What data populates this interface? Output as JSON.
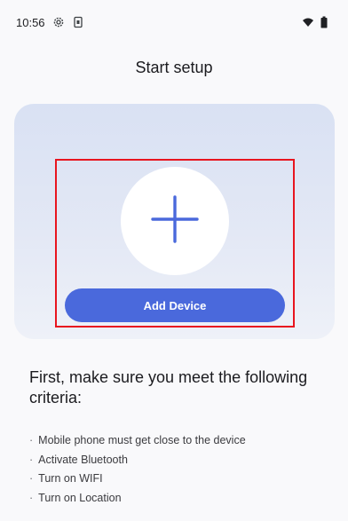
{
  "status_bar": {
    "time": "10:56",
    "icons": [
      "gear-icon",
      "phone-battery-icon",
      "wifi-icon",
      "battery-icon"
    ]
  },
  "header": {
    "title": "Start setup"
  },
  "card": {
    "plus_icon": "plus-icon",
    "add_device_label": "Add Device",
    "button_color": "#4a69dc",
    "highlight_color": "#e8151f"
  },
  "criteria": {
    "title": "First, make sure you meet the following criteria:",
    "bullet": "·",
    "items": [
      "Mobile phone must get close to the device",
      "Activate Bluetooth",
      "Turn on WIFI",
      "Turn on Location"
    ]
  }
}
